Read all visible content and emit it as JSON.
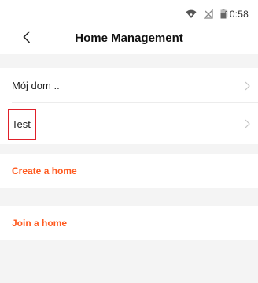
{
  "status_bar": {
    "time": "10:58",
    "icons": [
      "wifi-icon",
      "signal-off-icon",
      "battery-icon"
    ]
  },
  "header": {
    "title": "Home Management",
    "back_icon": "chevron-left-icon"
  },
  "homes": [
    {
      "label": "Mój dom ..",
      "icon": "chevron-right-icon"
    },
    {
      "label": "Test",
      "icon": "chevron-right-icon"
    }
  ],
  "actions": {
    "create_label": "Create a home",
    "join_label": "Join a home"
  },
  "colors": {
    "accent": "#ff5a1f",
    "background": "#f4f4f4",
    "highlight": "#e0202a"
  }
}
